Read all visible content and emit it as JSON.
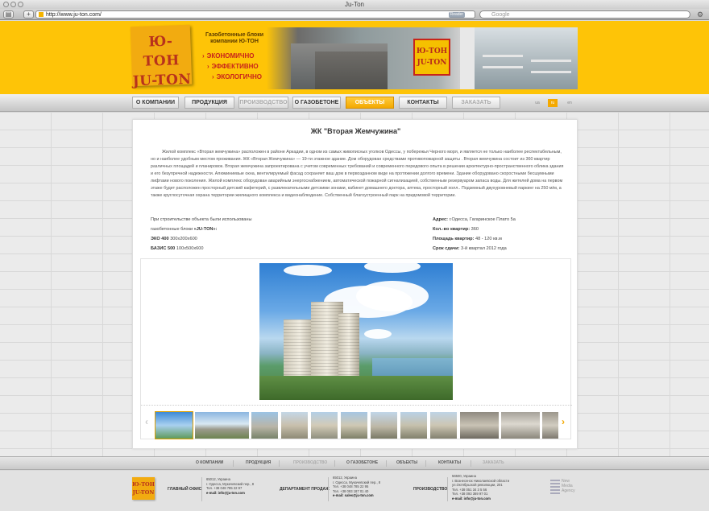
{
  "browser": {
    "window_title": "Ju-Ton",
    "url": "http://www.ju-ton.com/",
    "reader_label": "Reader",
    "search_placeholder": "Google"
  },
  "header": {
    "logo_line1": "Ю-ТОН",
    "logo_line2": "JU-TON",
    "slogan": "Газобетонные блоки компании Ю-ТОН",
    "bullets": [
      "ЭКОНОМИЧНО",
      "ЭФФЕКТИВНО",
      "ЭКОЛОГИЧНО"
    ],
    "banner_sign_line1": "Ю-ТОН",
    "banner_sign_line2": "JU-TON"
  },
  "nav": {
    "items": [
      "О КОМПАНИИ",
      "ПРОДУКЦИЯ",
      "ПРОИЗВОДСТВО",
      "О ГАЗОБЕТОНЕ",
      "ОБЪЕКТЫ",
      "КОНТАКТЫ",
      "ЗАКАЗАТЬ"
    ],
    "active": "ОБЪЕКТЫ",
    "langs": [
      "ua",
      "ru",
      "en"
    ],
    "active_lang": "ru"
  },
  "content": {
    "title": "ЖК \"Вторая Жемчужина\"",
    "description": "Жилой комплекс «Вторая жемчужина» расположен в районе Аркадии, в одном из самых живописных уголков Одессы, у побережья Черного моря, и является не только наиболее респектабельным, но и наиболее удобным местом проживания. ЖК «Вторая Жемчужина» — 19-ти этажное здание. Дом оборудован средствами противопожарной защиты . Вторая жемчужина состоит из 360 квартир различных площадей и планировок. Вторая жемчужина запроектирована с учетом современных требований и современного передового опыта в решении архитектурно-пространственного облика здания и его безупречной надежности. Алюминиевые окна, вентилируемый фасад сохраняет ваш дом в первозданном виде на протяжении долгого времени. Здание оборудовано скоростными бесшумными лифтами нового поколения. Жилой комплекс оборудован аварийным энергоснабжением, автоматической пожарной сигнализацией, собственным резервуаром запаса воды. Для жителей дома на первом этаже будет расположен просторный детский кафетерий, с развлекательными детскими зонами, кабинет домашнего доктора, аптека, просторный холл.. Подземный двухуровневый паркинг на 250 м/м, а также круглосуточная охрана территории жилищного комплекса и видеонаблюдение. Собственный благоустроенный парк на придомовой территории.",
    "blocks_intro_line1": "При строительстве объекта были использованы",
    "blocks_intro_line2_prefix": "газобетонные блоки ",
    "blocks_brand": "«JU-TON»:",
    "block1_name": "ЭКО 400",
    "block1_size": " 300x200x600",
    "block2_name": "БАЗИС 500",
    "block2_size": " 100x500x600",
    "address_label": "Адрес:",
    "address_value": " г.Одесса, Гагаринское Плато 5а",
    "apartments_label": "Кол.-во квартир:",
    "apartments_value": " 360",
    "area_label": "Площадь квартир:",
    "area_value": " 48 - 120 кв.м",
    "deadline_label": "Срок сдачи:",
    "deadline_value": " 3-й квартал 2012 года"
  },
  "gallery": {
    "thumb_count": 12,
    "prev_icon": "‹",
    "next_icon": "›"
  },
  "footer": {
    "nav": [
      "О КОМПАНИИ",
      "ПРОДУКЦИЯ",
      "ПРОИЗВОДСТВО",
      "О ГАЗОБЕТОНЕ",
      "ОБЪЕКТЫ",
      "КОНТАКТЫ",
      "ЗАКАЗАТЬ"
    ],
    "logo_line1": "Ю-ТОН",
    "logo_line2": "JU-TON",
    "office_title": "ГЛАВНЫЙ ОФИС",
    "office_lines": [
      "65012, Украина",
      "г. Одесса, Мукачевский пер., 8",
      "Тел. +38 048 785 22 97",
      "e-mail: info@ju-ton.com"
    ],
    "sales_title": "ДЕПАРТАМЕНТ ПРОДАЖ",
    "sales_lines": [
      "65012, Украина",
      "г. Одесса, Мукачевский пер., 8",
      "Тел. +38 048 785 22 95",
      "Тел. +38 093 187 01 40",
      "e-mail: sales@ju-ton.com"
    ],
    "production_title": "ПРОИЗВОДСТВО",
    "production_lines": [
      "56500, Украина",
      "г. Вознесенск Николаевской области",
      "ул.Октябрьской революции, 201",
      "Тел. +38 051 34 3 5 56",
      "Тел. +38 093 369 97 01",
      "e-mail: info@ju-ton.com"
    ],
    "agency_line1": "New",
    "agency_line2": "Media",
    "agency_line3": "Agency"
  }
}
